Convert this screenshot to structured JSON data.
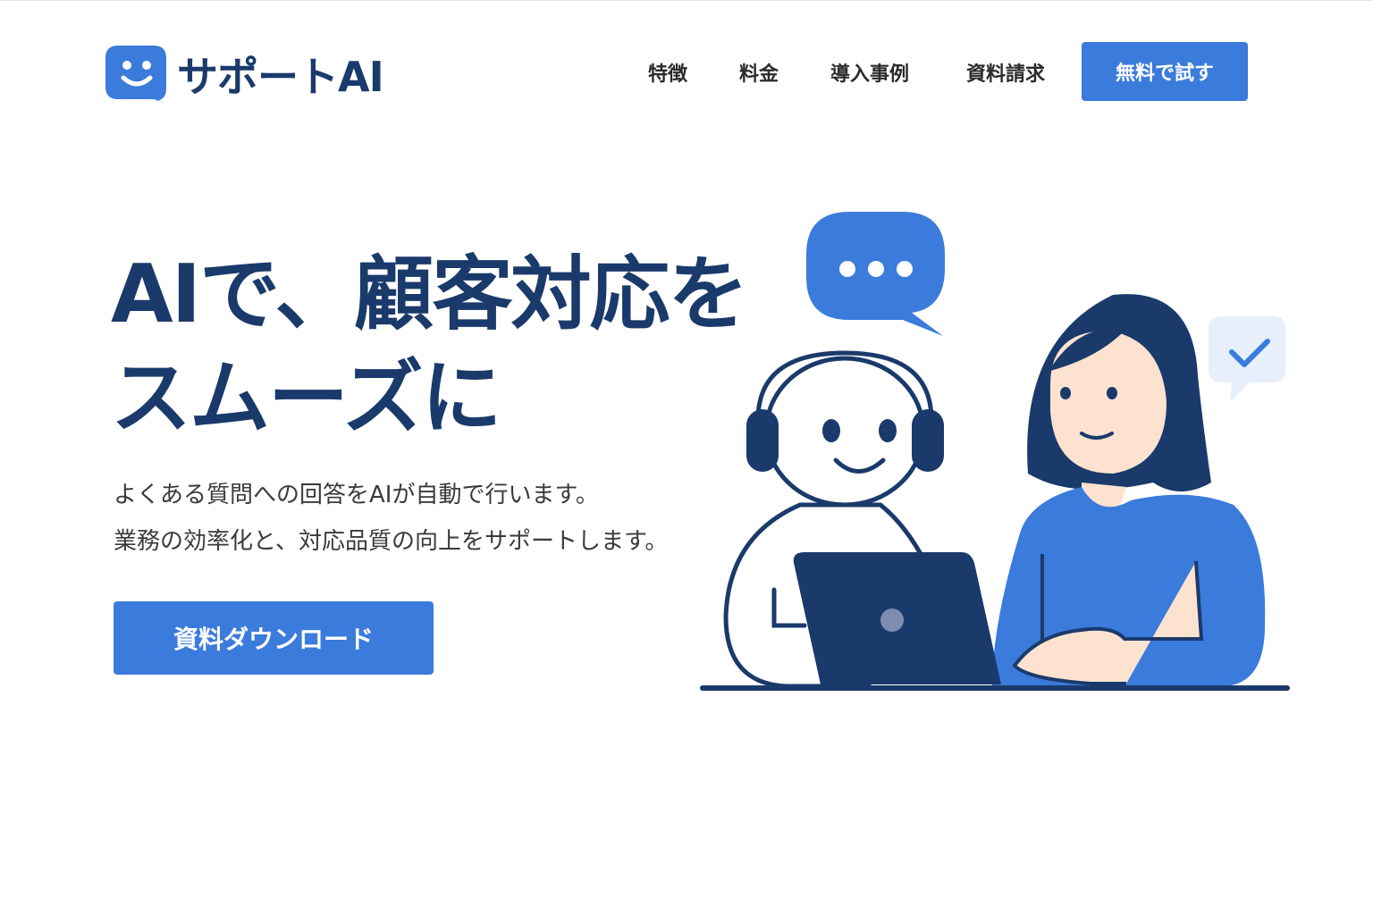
{
  "brand": {
    "name": "サポートAI",
    "accent": "#3b7bdb",
    "navy": "#1a3a6b"
  },
  "nav": {
    "items": [
      {
        "label": "特徴"
      },
      {
        "label": "料金"
      },
      {
        "label": "導入事例"
      },
      {
        "label": "資料請求"
      }
    ],
    "cta_label": "無料で試す"
  },
  "hero": {
    "title_line1": "AIで、顧客対応を",
    "title_line2": "スムーズに",
    "sub_line1": "よくある質問への回答をAIが自動で行います。",
    "sub_line2": "業務の効率化と、対応品質の向上をサポートします。",
    "cta_label": "資料ダウンロード"
  },
  "illustration": {
    "icons": [
      "chat-bubble-dots-icon",
      "check-bubble-icon",
      "robot-with-headset",
      "woman-with-laptop"
    ]
  }
}
